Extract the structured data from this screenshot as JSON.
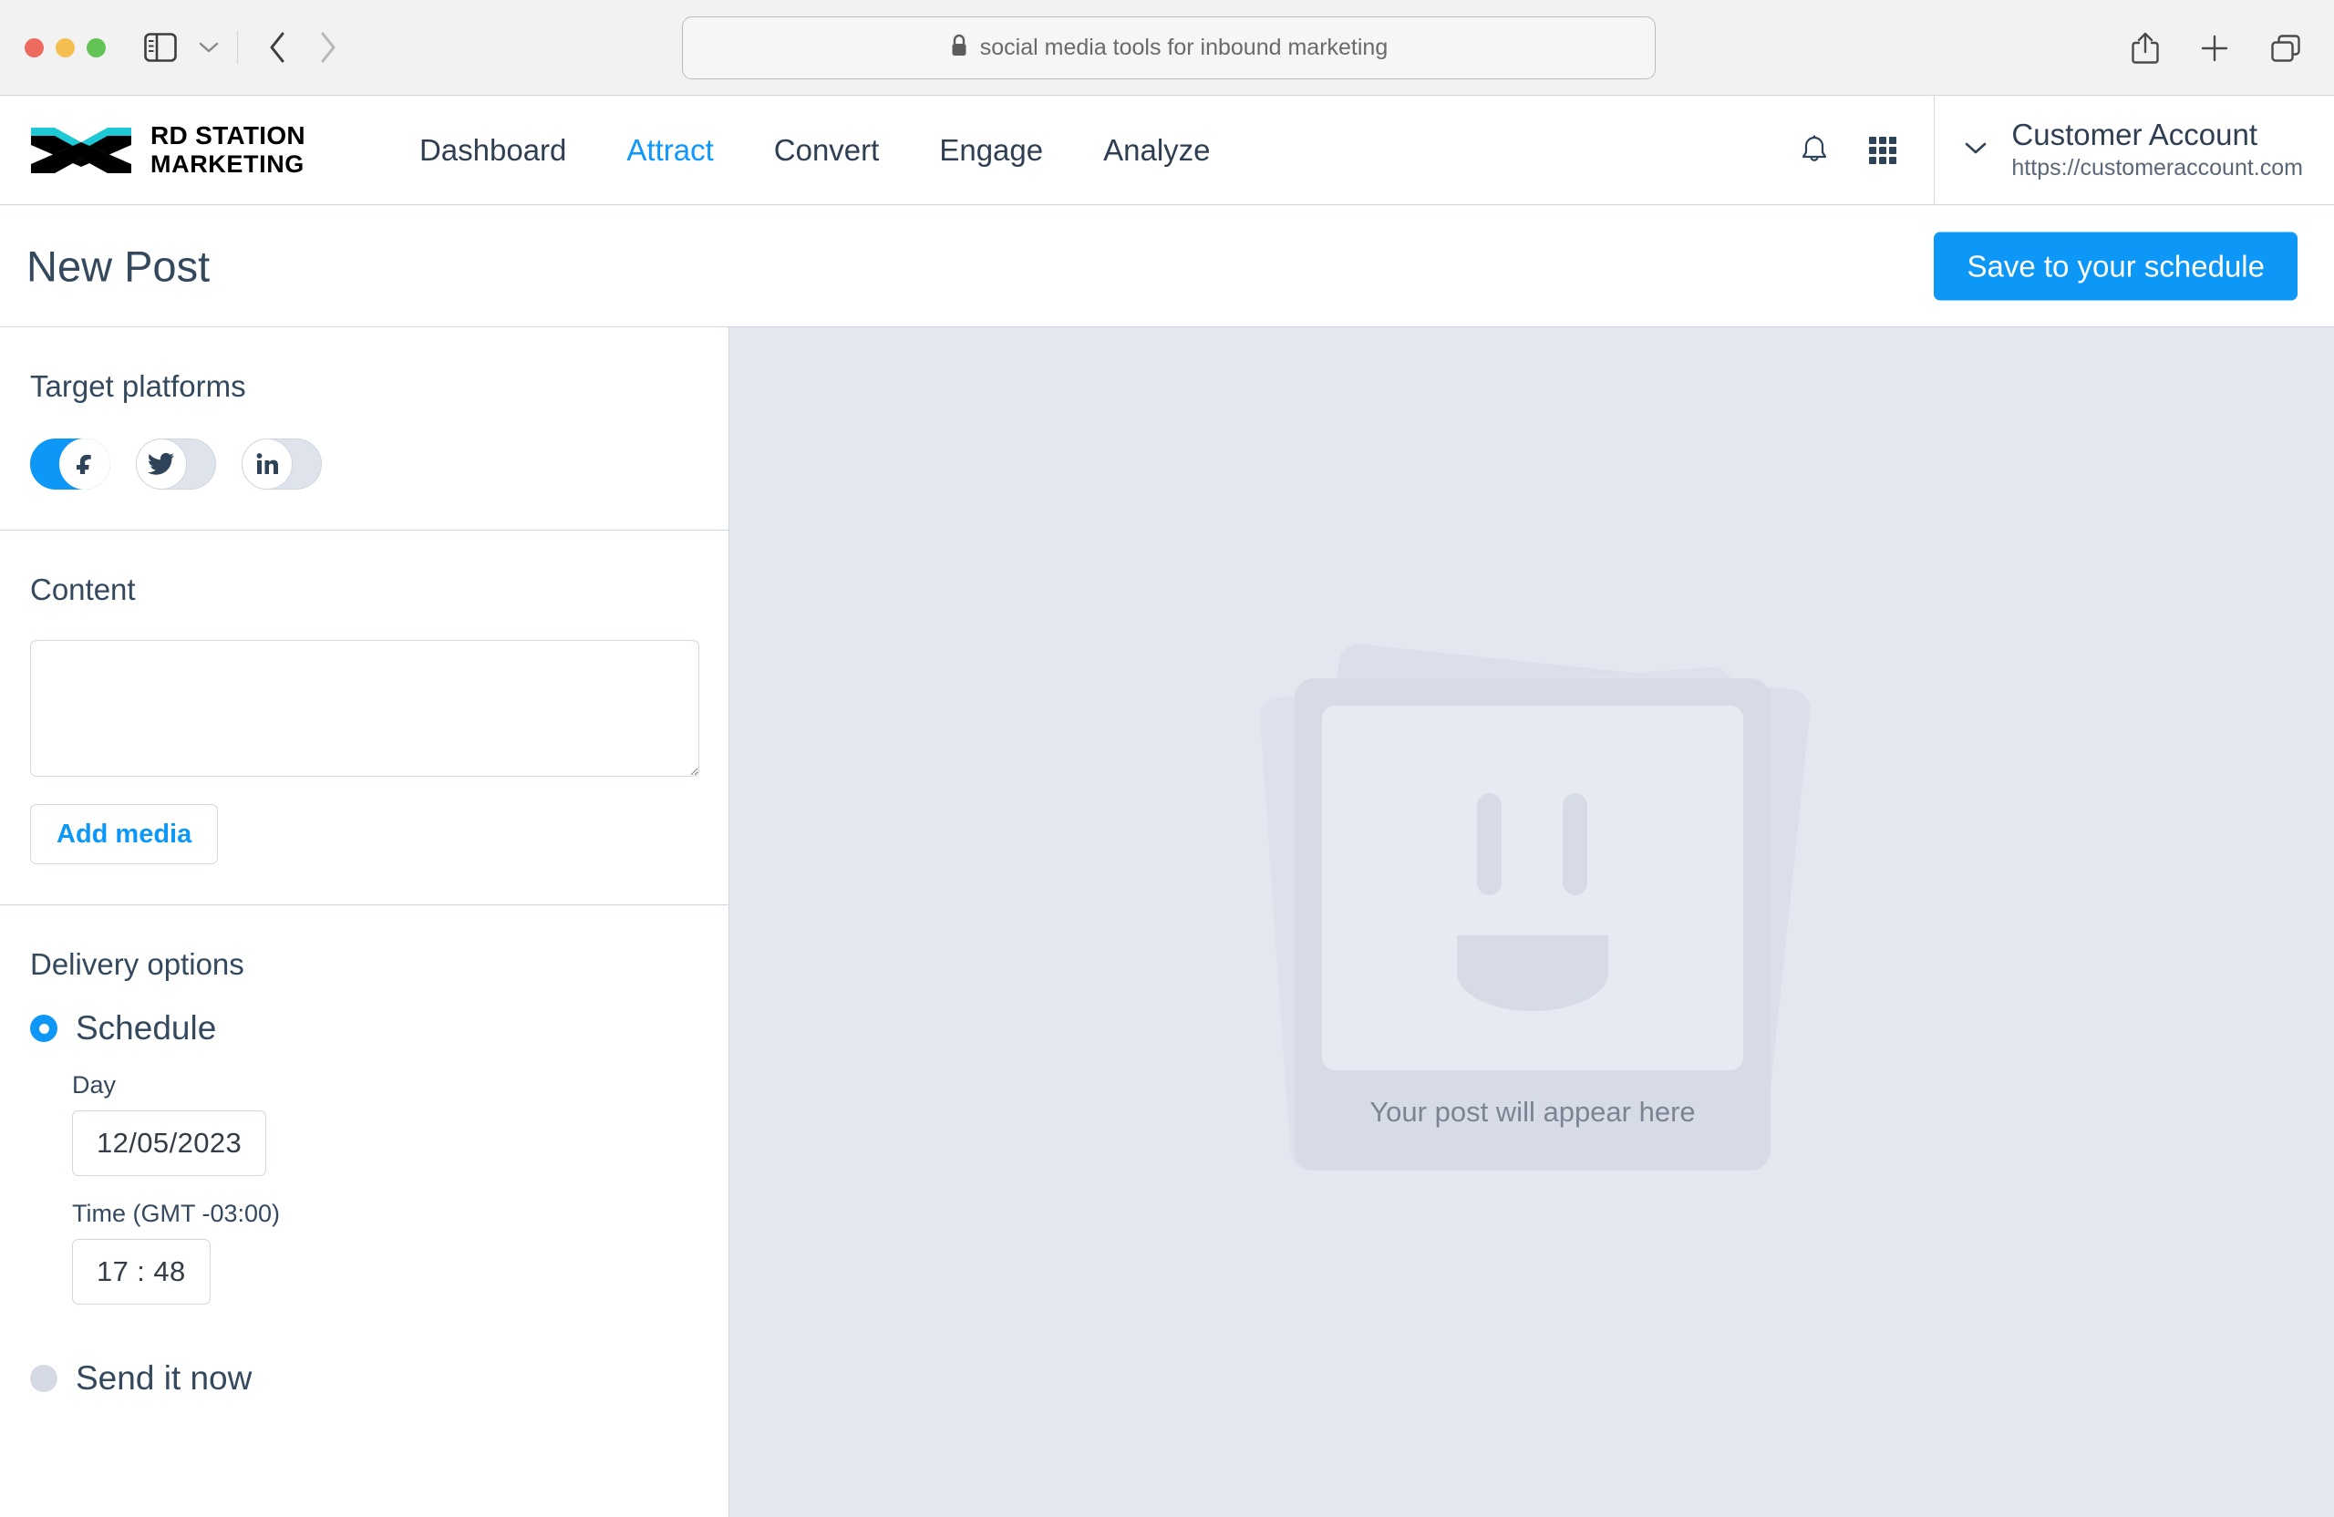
{
  "browser": {
    "url_text": "social media tools for inbound marketing",
    "lock_icon": "lock-icon",
    "sidebar_icon": "sidebar-toggle-icon",
    "tab_overview_chevron": "chevron-down-icon",
    "back_icon": "back-chevron-icon",
    "forward_icon": "forward-chevron-icon",
    "share_icon": "share-icon",
    "newtab_icon": "plus-icon",
    "tabs_icon": "tab-overview-icon"
  },
  "app_header": {
    "logo": {
      "line1_bold": "RD",
      "line1_rest": " STATION",
      "line2": "MARKETING",
      "mark_icon": "rd-station-chevrons-logo"
    },
    "nav": [
      {
        "label": "Dashboard",
        "active": false
      },
      {
        "label": "Attract",
        "active": true
      },
      {
        "label": "Convert",
        "active": false
      },
      {
        "label": "Engage",
        "active": false
      },
      {
        "label": "Analyze",
        "active": false
      }
    ],
    "bell_icon": "notification-bell-icon",
    "apps_icon": "apps-grid-icon",
    "account_chevron": "chevron-down-icon",
    "account_name": "Customer Account",
    "account_url": "https://customeraccount.com"
  },
  "page": {
    "title": "New Post",
    "save_label": "Save to your schedule"
  },
  "target_platforms": {
    "heading": "Target platforms",
    "toggles": [
      {
        "name": "facebook",
        "icon": "facebook-icon",
        "state": "on",
        "glyph": "f"
      },
      {
        "name": "twitter",
        "icon": "twitter-icon",
        "state": "off",
        "glyph": "t"
      },
      {
        "name": "linkedin",
        "icon": "linkedin-icon",
        "state": "off",
        "glyph": "in"
      }
    ]
  },
  "content": {
    "heading": "Content",
    "textarea_value": "",
    "textarea_placeholder": "",
    "add_media_label": "Add media"
  },
  "delivery": {
    "heading": "Delivery options",
    "schedule_label": "Schedule",
    "schedule_selected": true,
    "day_label": "Day",
    "day_value": "12/05/2023",
    "time_label": "Time (GMT -03:00)",
    "time_value": "17 : 48",
    "send_now_label": "Send it now",
    "send_now_selected": false
  },
  "preview": {
    "caption": "Your post will appear here",
    "placeholder_icon": "smiley-photo-placeholder-icon"
  },
  "colors": {
    "accent_blue": "#0d97f7",
    "text_dark": "#34495e",
    "panel_bg": "#e4e7f0",
    "border": "#cfd6e4"
  }
}
